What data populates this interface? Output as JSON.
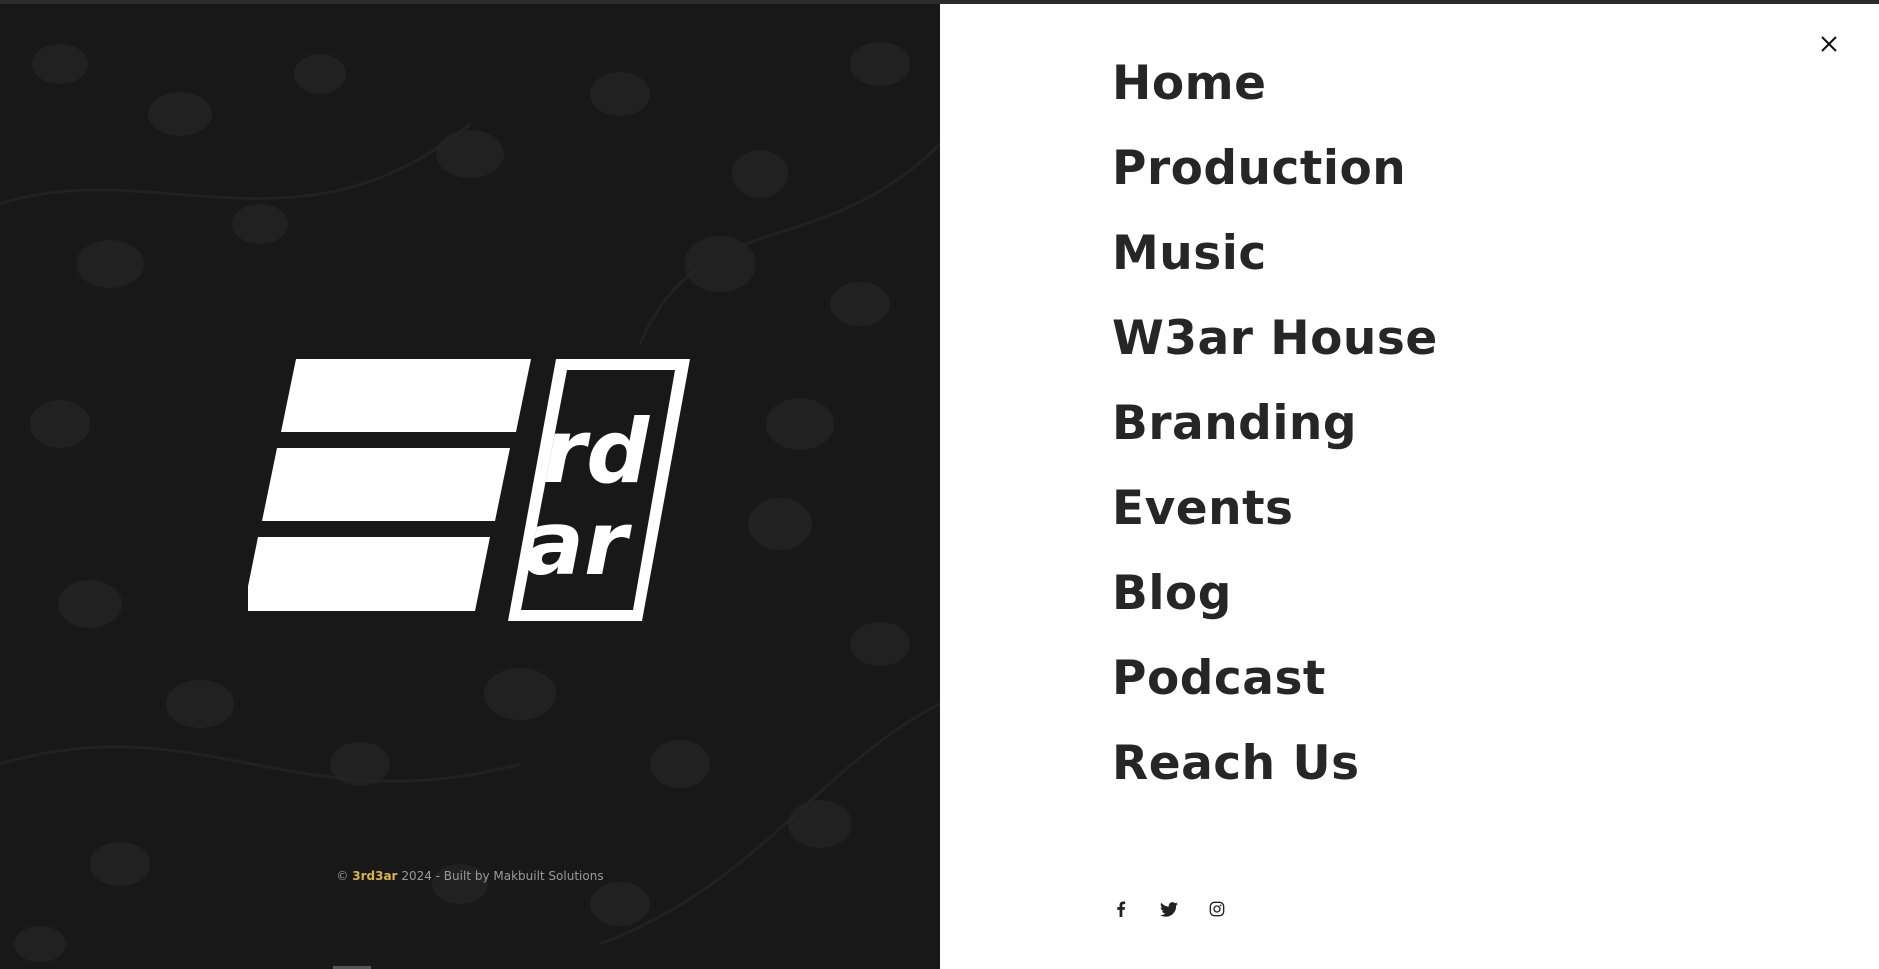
{
  "logo": {
    "line1": "rd",
    "line2": "ar",
    "name": "3rd3ar"
  },
  "footer": {
    "copyright_symbol": "©",
    "brand": "3rd3ar",
    "rest": "2024 - Built by Makbuilt Solutions"
  },
  "menu": {
    "close_label": "×",
    "items": [
      {
        "label": "Home"
      },
      {
        "label": "Production"
      },
      {
        "label": "Music"
      },
      {
        "label": "W3ar House"
      },
      {
        "label": "Branding"
      },
      {
        "label": "Events"
      },
      {
        "label": "Blog"
      },
      {
        "label": "Podcast"
      },
      {
        "label": "Reach Us"
      }
    ]
  },
  "socials": [
    {
      "icon": "facebook-icon"
    },
    {
      "icon": "twitter-icon"
    },
    {
      "icon": "instagram-icon"
    }
  ],
  "colors": {
    "left_bg": "#181818",
    "right_bg": "#ffffff",
    "menu_text": "#262626",
    "brand_accent": "#d9b44a",
    "footer_text": "#9a9a9a"
  }
}
